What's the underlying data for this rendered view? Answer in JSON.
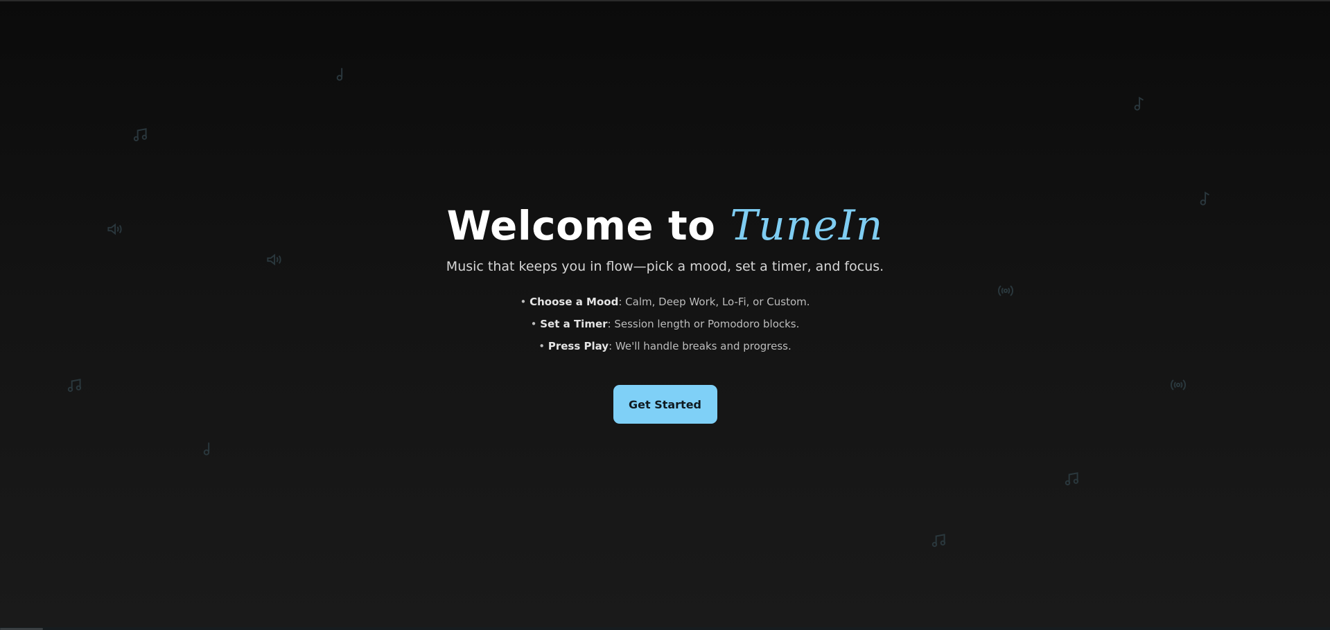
{
  "hero": {
    "title_prefix": "Welcome to ",
    "brand": "TuneIn",
    "subtitle": "Music that keeps you in flow—pick a mood, set a timer, and focus.",
    "features": [
      {
        "bullet": "• ",
        "label": "Choose a Mood",
        "text": ": Calm, Deep Work, Lo-Fi, or Custom."
      },
      {
        "bullet": "• ",
        "label": "Set a Timer",
        "text": ": Session length or Pomodoro blocks."
      },
      {
        "bullet": "• ",
        "label": "Press Play",
        "text": ": We'll handle breaks and progress."
      }
    ],
    "cta_label": "Get Started"
  },
  "colors": {
    "background_top": "#0b0b0b",
    "background_bottom": "#1a1a1a",
    "brand_accent": "#7fcdf2",
    "cta_background": "#7fd0f7",
    "decor_icon": "#2c3a40"
  },
  "decor_icons": [
    "music-note-icon",
    "music-notes-icon",
    "music-note-icon",
    "music-note-icon",
    "speaker-icon",
    "speaker-icon",
    "broadcast-icon",
    "music-notes-icon",
    "broadcast-icon",
    "music-note-icon",
    "music-notes-icon",
    "music-notes-icon"
  ]
}
